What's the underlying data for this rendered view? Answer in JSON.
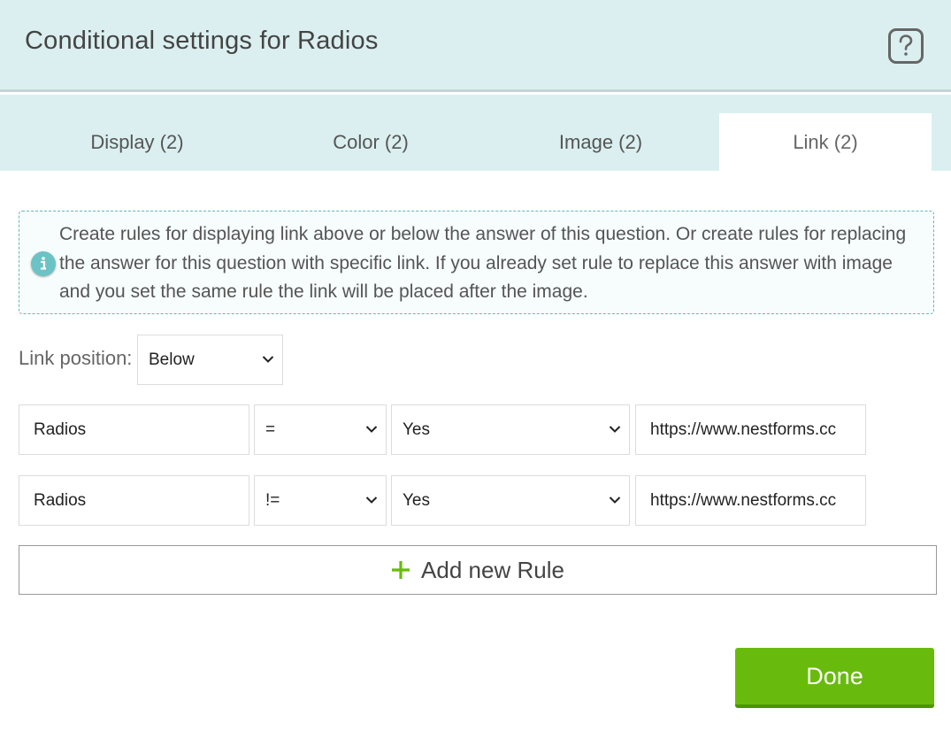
{
  "header": {
    "title": "Conditional settings for Radios"
  },
  "tabs": [
    {
      "label": "Display (2)"
    },
    {
      "label": "Color (2)"
    },
    {
      "label": "Image (2)"
    },
    {
      "label": "Link (2)"
    }
  ],
  "active_tab": "Link (2)",
  "info": {
    "text": "Create rules for displaying link above or below the answer of this question. Or create rules for replacing the answer for this question with specific link. If you already set rule to replace this answer with image and you set the same rule the link will be placed after the image."
  },
  "link_position": {
    "label": "Link position:",
    "value": "Below"
  },
  "rules": [
    {
      "field": "Radios",
      "operator": "=",
      "value": "Yes",
      "url": "https://www.nestforms.cc"
    },
    {
      "field": "Radios",
      "operator": "!=",
      "value": "Yes",
      "url": "https://www.nestforms.cc"
    }
  ],
  "add_rule_label": "Add new Rule",
  "done_label": "Done",
  "colors": {
    "header_bg": "#dbeff0",
    "accent_green": "#68bb0c",
    "info_border": "#5fb9bd"
  }
}
